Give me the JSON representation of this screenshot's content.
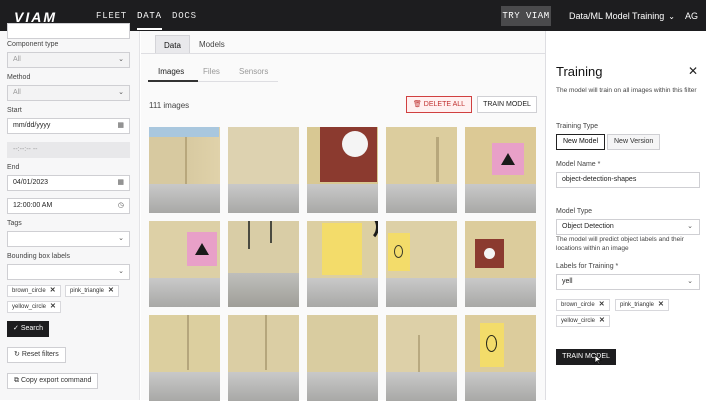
{
  "nav": {
    "logo": "VIAM",
    "links": [
      "FLEET",
      "DATA",
      "DOCS"
    ],
    "active": "DATA",
    "try_label": "TRY VIAM",
    "org": "Data/ML Model Training",
    "initials": "AG"
  },
  "sidebar": {
    "component_type_label": "Component type",
    "component_type_value": "All",
    "method_label": "Method",
    "method_value": "All",
    "start_label": "Start",
    "start_placeholder": "mm/dd/yyyy",
    "start_time_placeholder": "--:--:-- --",
    "end_label": "End",
    "end_date": "04/01/2023",
    "end_time": "12:00:00 AM",
    "tags_label": "Tags",
    "bbox_label": "Bounding box labels",
    "bbox_chips": [
      "brown_circle",
      "pink_triangle",
      "yellow_circle"
    ],
    "search_label": "Search",
    "reset_label": "Reset filters",
    "export_label": "Copy export command"
  },
  "main": {
    "tabs": [
      "Data",
      "Models"
    ],
    "subtabs": [
      "Images",
      "Files",
      "Sensors"
    ],
    "count": "111 images",
    "delete_all": "DELETE ALL",
    "train_model": "TRAIN MODEL"
  },
  "panel": {
    "title": "Training",
    "description": "The model will train on all images within this filter",
    "training_type_label": "Training Type",
    "training_type_options": [
      "New Model",
      "New Version"
    ],
    "training_type_selected": "New Model",
    "model_name_label": "Model Name *",
    "model_name_value": "object-detection-shapes",
    "model_type_label": "Model Type",
    "model_type_value": "Object Detection",
    "model_type_note": "The model will predict object labels and their locations within an image",
    "labels_label": "Labels for Training *",
    "labels_input": "yell",
    "label_chips": [
      "brown_circle",
      "pink_triangle",
      "yellow_circle"
    ],
    "train_button": "TRAIN MODEL"
  },
  "colors": {
    "nav_bg": "#1d1d1f",
    "accent_danger": "#c0302f",
    "wood": "#d8c48f",
    "pink": "#e8a0c8",
    "brown": "#8b3a2f",
    "yellow": "#f3dc6a"
  }
}
